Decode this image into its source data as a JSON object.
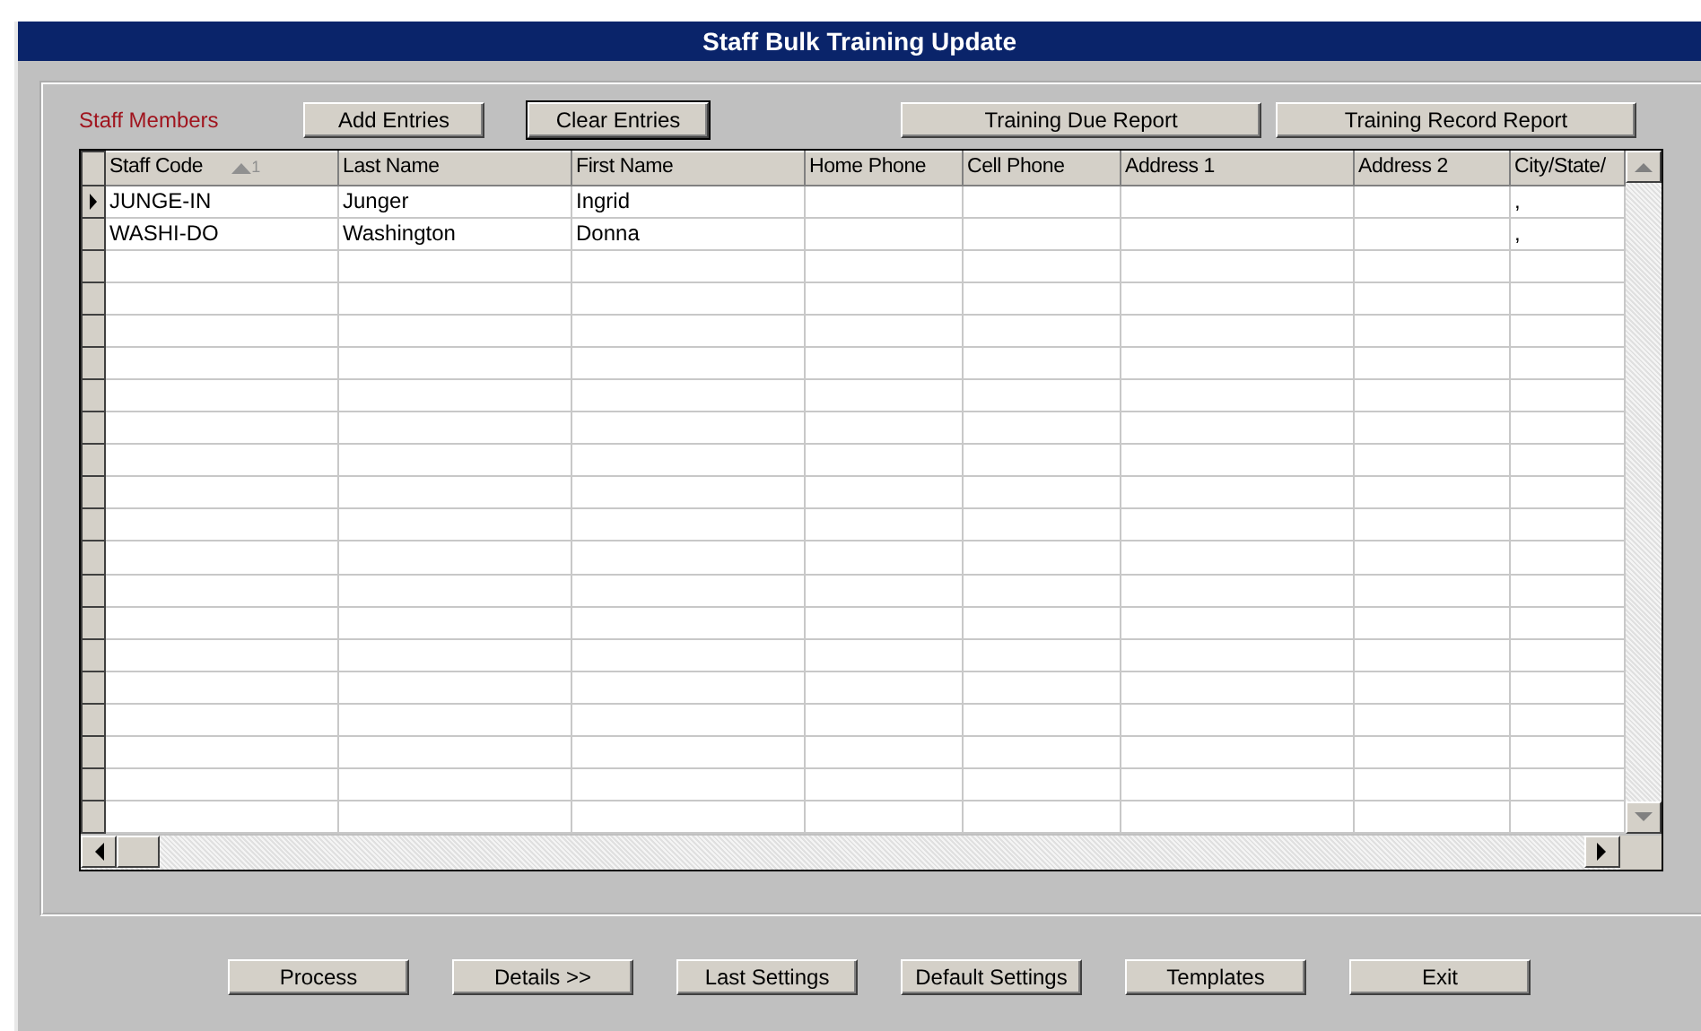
{
  "window": {
    "title": "Staff Bulk Training Update"
  },
  "section_label": "Staff Members",
  "top_buttons": [
    {
      "label": "Add Entries",
      "focused": false
    },
    {
      "label": "Clear Entries",
      "focused": true
    },
    {
      "label": "Training Due Report",
      "focused": false
    },
    {
      "label": "Training Record Report",
      "focused": false
    }
  ],
  "table": {
    "columns": [
      {
        "label": "Staff Code",
        "sorted": true,
        "sort_rank": "1"
      },
      {
        "label": "Last Name",
        "sorted": false
      },
      {
        "label": "First Name",
        "sorted": false
      },
      {
        "label": "Home Phone",
        "sorted": false
      },
      {
        "label": "Cell Phone",
        "sorted": false
      },
      {
        "label": "Address 1",
        "sorted": false
      },
      {
        "label": "Address 2",
        "sorted": false
      },
      {
        "label": "City/State/",
        "sorted": false
      }
    ],
    "rows": [
      {
        "current": true,
        "cells": [
          "JUNGE-IN",
          "Junger",
          "Ingrid",
          "",
          "",
          "",
          "",
          ","
        ]
      },
      {
        "current": false,
        "cells": [
          "WASHI-DO",
          "Washington",
          "Donna",
          "",
          "",
          "",
          "",
          ","
        ]
      }
    ]
  },
  "bottom_buttons": [
    "Process",
    "Details >>",
    "Last Settings",
    "Default Settings",
    "Templates",
    "Exit"
  ]
}
